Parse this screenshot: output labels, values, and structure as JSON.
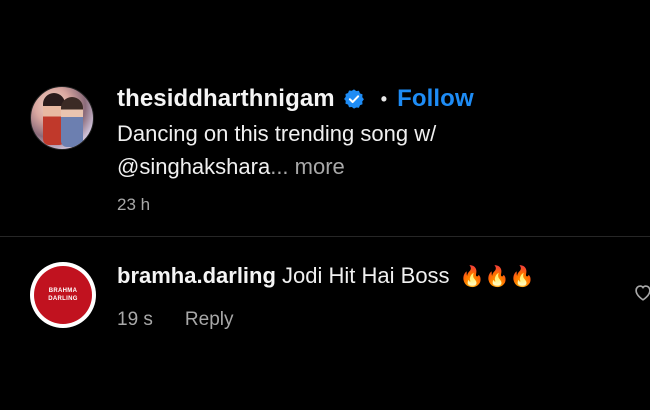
{
  "post": {
    "avatar_icon": "profile-photo-couple",
    "username": "thesiddharthnigam",
    "verified_icon": "verified-badge-icon",
    "separator": "•",
    "follow_label": "Follow",
    "caption_line1": "Dancing on this trending song w/",
    "caption_line2": "@singhakshara",
    "more_label": "... more",
    "timestamp": "23 h"
  },
  "comment": {
    "avatar_lines": [
      "BRAHMA",
      "DARLING"
    ],
    "username": "bramha.darling",
    "text": "Jodi Hit Hai Boss",
    "emojis": "🔥🔥🔥",
    "time": "19 s",
    "reply_label": "Reply",
    "like_icon": "heart-outline-icon"
  },
  "colors": {
    "background": "#000000",
    "follow": "#1e8cf5",
    "verified": "#1e8cf5",
    "secondary_text": "#a8a8a8",
    "avatar_red": "#c1121f"
  }
}
